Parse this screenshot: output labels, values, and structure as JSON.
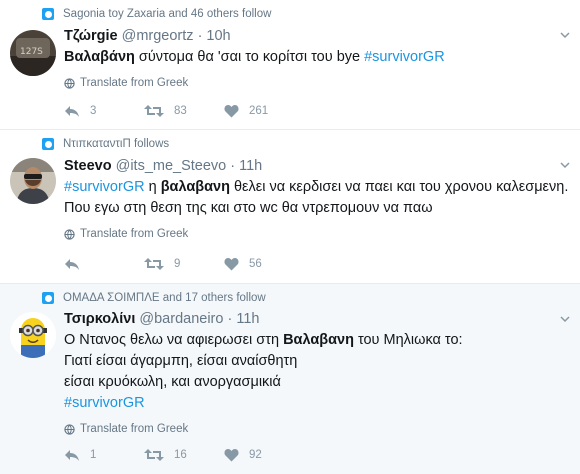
{
  "tweets": [
    {
      "context": "Sagonia toy Zaxaria and 46 others follow",
      "name": "Τζώrgie",
      "handle": "@mrgeortz",
      "time": "· 10h",
      "lines": [
        [
          {
            "t": "Βαλαβάνη",
            "b": true
          },
          {
            "t": " σύντομα θα 'σαι το κορίτσι του bye "
          },
          {
            "t": "#survivorGR",
            "tag": true
          }
        ]
      ],
      "translate": "Translate from Greek",
      "replies": "3",
      "retweets": "83",
      "likes": "261"
    },
    {
      "context": "ΝτιπκαταντιΠ follows",
      "name": "Steevo",
      "handle": "@its_me_Steevo",
      "time": "· 11h",
      "lines": [
        [
          {
            "t": "#survivorGR",
            "tag": true
          },
          {
            "t": " η "
          },
          {
            "t": "βαλαβανη",
            "b": true
          },
          {
            "t": " θελει να κερδισει να παει και του χρονου καλεσμενη."
          }
        ],
        [
          {
            "t": "Που εγω στη θεση της και στο wc θα ντρεπομουν να παω"
          }
        ]
      ],
      "translate": "Translate from Greek",
      "replies": "",
      "retweets": "9",
      "likes": "56"
    },
    {
      "context": "ΟΜΑΔΑ ΣΟΙΜΠΛΕ and 17 others follow",
      "name": "Τσιρκολίνι",
      "handle": "@bardaneiro",
      "time": "· 11h",
      "lines": [
        [
          {
            "t": "Ο Ντανος θελω να αφιερωσει στη "
          },
          {
            "t": "Βαλαβανη",
            "b": true
          },
          {
            "t": " του Μηλιωκα το:"
          }
        ],
        [
          {
            "t": "Γιατί είσαι άγαρμπη, είσαι αναίσθητη"
          }
        ],
        [
          {
            "t": "είσαι κρυόκωλη, και ανοργασμικιά"
          }
        ],
        [
          {
            "t": "#survivorGR",
            "tag": true
          }
        ]
      ],
      "translate": "Translate from Greek",
      "replies": "1",
      "retweets": "16",
      "likes": "92"
    }
  ],
  "colors": {
    "accent": "#1da1f2",
    "hashtag": "#1b95e0",
    "muted": "#657786",
    "highlight_bg": "#f5f8fa"
  },
  "icons": [
    "person-icon",
    "chevron-down-icon",
    "globe-icon",
    "reply-icon",
    "retweet-icon",
    "heart-icon"
  ]
}
